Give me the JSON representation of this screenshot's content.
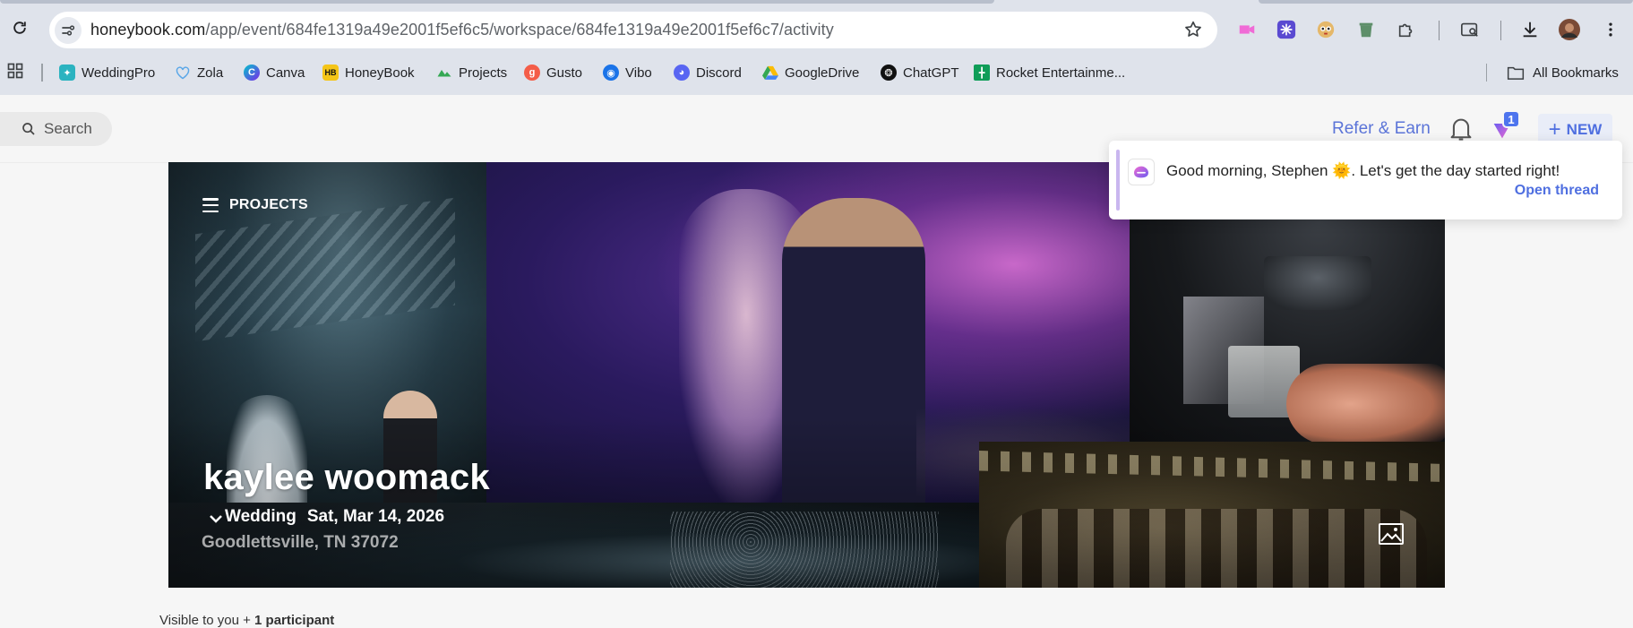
{
  "browser": {
    "url_host": "honeybook.com",
    "url_path": "/app/event/684fe1319a49e2001f5ef6c5/workspace/684fe1319a49e2001f5ef6c7/activity",
    "bookmarks": [
      {
        "label": "WeddingPro",
        "icon": "weddingpro-icon",
        "color": "#2bb3c0"
      },
      {
        "label": "Zola",
        "icon": "heart-icon",
        "color": "#5aa7e8"
      },
      {
        "label": "Canva",
        "icon": "canva-icon",
        "color": "#7d2ae8"
      },
      {
        "label": "HoneyBook",
        "icon": "honeybook-icon",
        "color": "#f5c518"
      },
      {
        "label": "Projects",
        "icon": "projects-icon",
        "color": "#34a853"
      },
      {
        "label": "Gusto",
        "icon": "gusto-icon",
        "color": "#f45d48"
      },
      {
        "label": "Vibo",
        "icon": "vibo-icon",
        "color": "#1a73e8"
      },
      {
        "label": "Discord",
        "icon": "discord-icon",
        "color": "#5865f2"
      },
      {
        "label": "GoogleDrive",
        "icon": "google-drive-icon",
        "color": "#fbbc04"
      },
      {
        "label": "ChatGPT",
        "icon": "chatgpt-icon",
        "color": "#111111"
      },
      {
        "label": "Rocket Entertainme...",
        "icon": "sheets-icon",
        "color": "#0f9d58"
      }
    ],
    "all_bookmarks_label": "All Bookmarks",
    "extensions": [
      "pink-video-extension-icon",
      "purple-star-extension-icon",
      "owl-extension-icon",
      "green-trash-extension-icon",
      "puzzle-extensions-icon",
      "search-tab-icon",
      "download-icon",
      "profile-avatar-icon",
      "kebab-menu-icon"
    ]
  },
  "header": {
    "search_label": "Search",
    "refer_label": "Refer & Earn",
    "notification_count": "1",
    "new_label": "NEW"
  },
  "hero": {
    "menu_label": "PROJECTS",
    "title": "kaylee woomack",
    "event_type": "Wedding",
    "date": "Sat, Mar 14, 2026",
    "location": "Goodlettsville, TN 37072"
  },
  "visibility": {
    "prefix": "Visible to you + ",
    "count": "1 participant"
  },
  "toast": {
    "message": "Good morning, Stephen 🌞. Let's get the day started right!",
    "link": "Open thread"
  },
  "colors": {
    "accent": "#4f6fe0",
    "brand_purple": "#8a5cf0"
  }
}
